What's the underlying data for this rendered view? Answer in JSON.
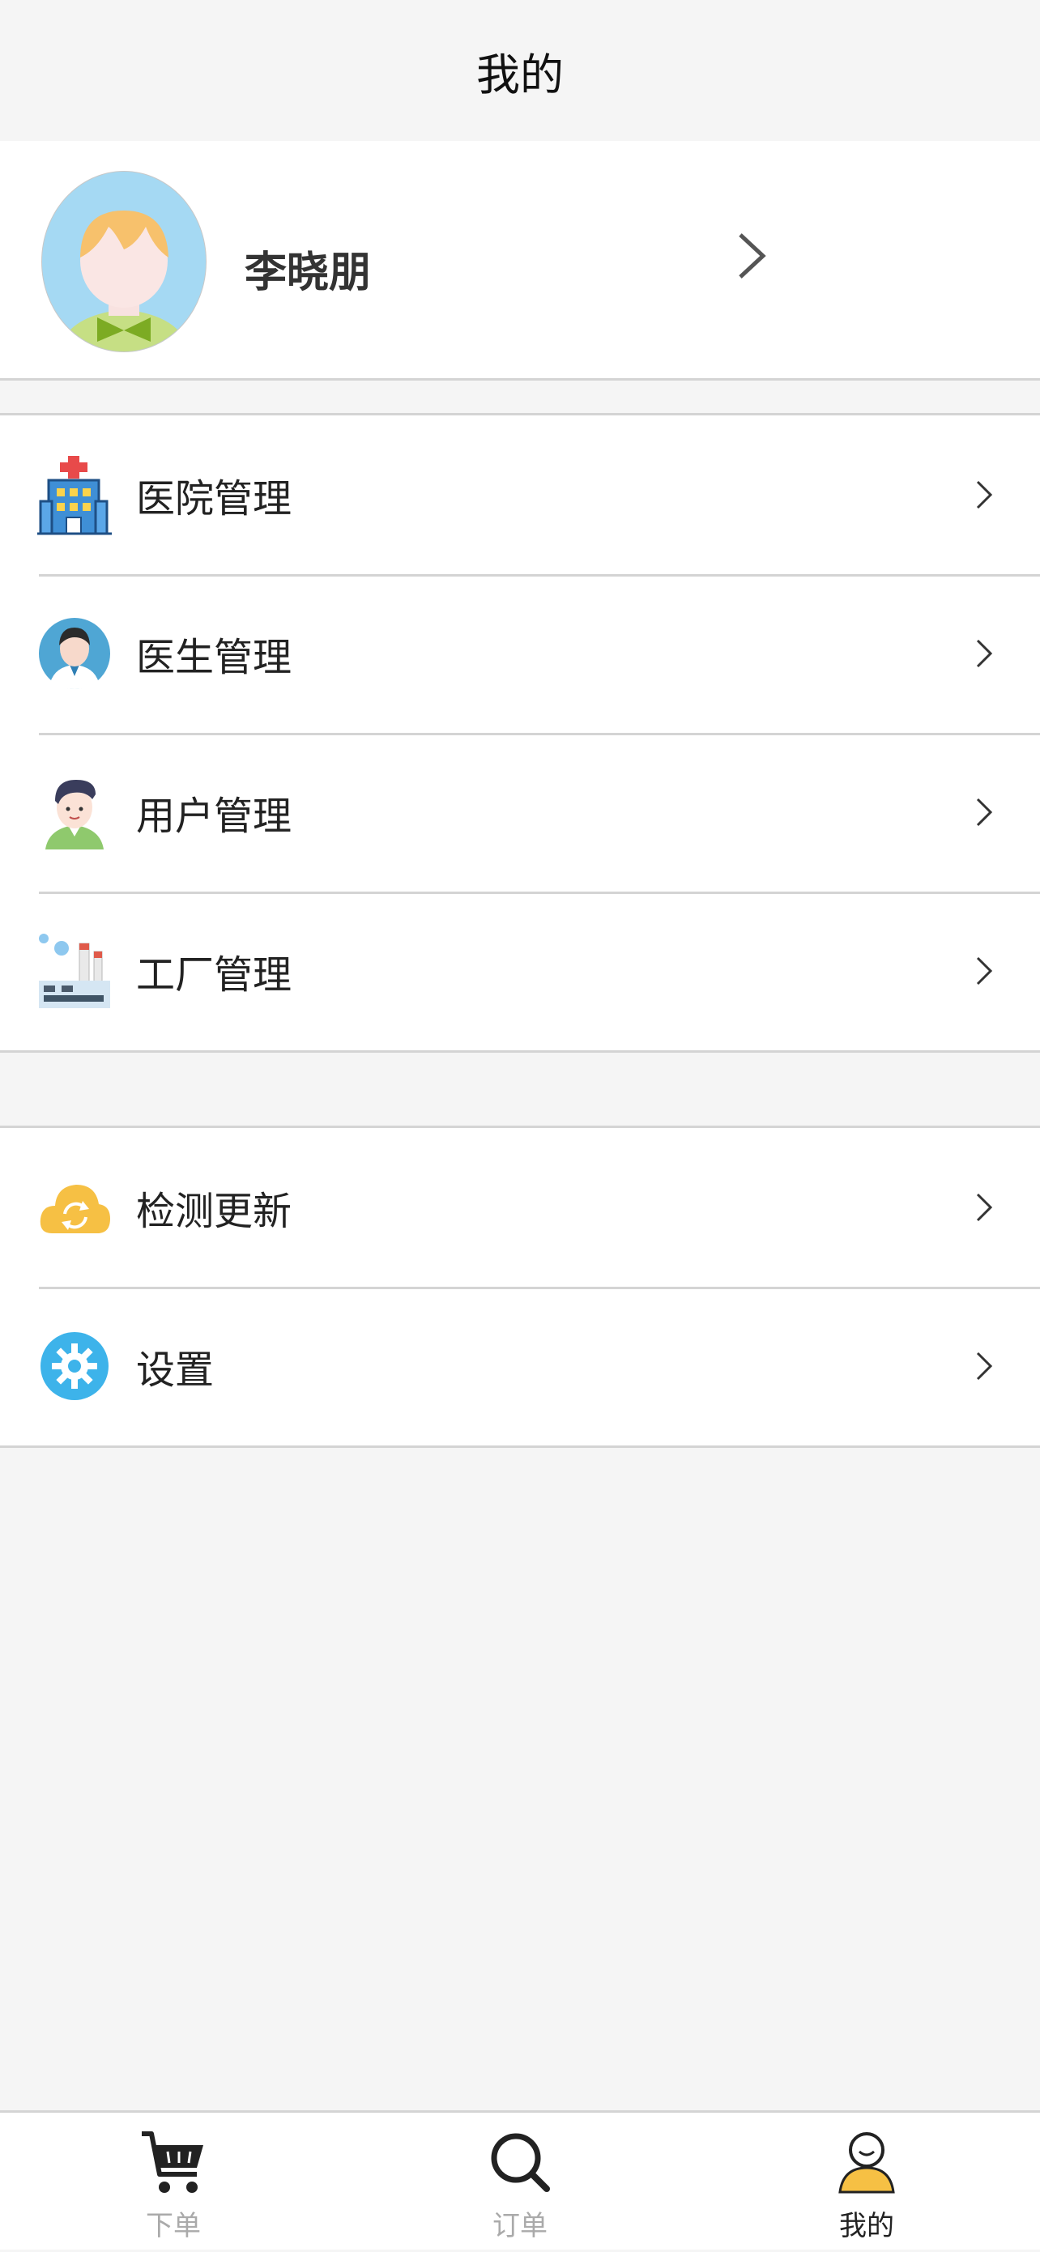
{
  "header": {
    "title": "我的"
  },
  "profile": {
    "name": "李晓朋"
  },
  "management": {
    "items": [
      {
        "label": "医院管理",
        "icon": "hospital-icon"
      },
      {
        "label": "医生管理",
        "icon": "doctor-icon"
      },
      {
        "label": "用户管理",
        "icon": "user-icon"
      },
      {
        "label": "工厂管理",
        "icon": "factory-icon"
      }
    ]
  },
  "system": {
    "items": [
      {
        "label": "检测更新",
        "icon": "update-cloud-icon"
      },
      {
        "label": "设置",
        "icon": "settings-gear-icon"
      }
    ]
  },
  "tabbar": {
    "tabs": [
      {
        "label": "下单",
        "icon": "cart-icon",
        "active": false
      },
      {
        "label": "订单",
        "icon": "search-icon",
        "active": false
      },
      {
        "label": "我的",
        "icon": "person-icon",
        "active": true
      }
    ]
  },
  "colors": {
    "background": "#f5f5f5",
    "divider": "#d4d4d4",
    "active_tab": "#222222",
    "inactive_tab": "#aaaaaa",
    "update_icon": "#f6c044",
    "settings_icon": "#3db3ea"
  }
}
